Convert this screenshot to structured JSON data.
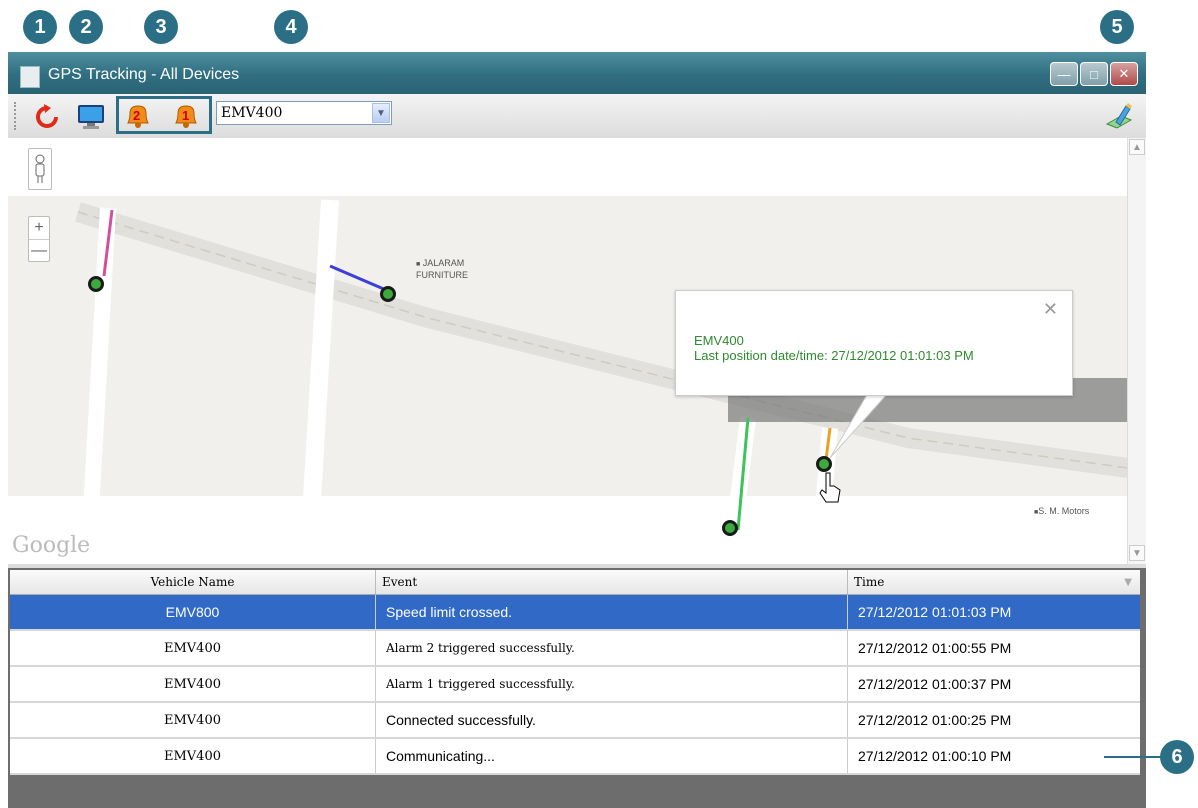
{
  "callouts": [
    "1",
    "2",
    "3",
    "4",
    "5",
    "6"
  ],
  "window": {
    "title": "GPS Tracking - All Devices",
    "controls": [
      "minimize-icon",
      "maximize-icon",
      "close-icon"
    ]
  },
  "toolbar": {
    "refresh_icon": "refresh-icon",
    "monitor_icon": "monitor-icon",
    "alarm2_label": "2",
    "alarm1_label": "1",
    "device_selected": "EMV400",
    "edit_icon": "pencil-icon"
  },
  "map": {
    "labels": {
      "jalaram": "JALARAM FURNITURE",
      "sm_motors": "S. M. Motors",
      "google": "Google"
    },
    "popup": {
      "vehicle": "EMV400",
      "last_position": "Last position date/time: 27/12/2012 01:01:03 PM"
    },
    "track_colors": {
      "pink": "#d24fa0",
      "blue": "#3b3fd6",
      "green": "#3cc35a",
      "orange": "#f0a020"
    }
  },
  "grid": {
    "columns": [
      "Vehicle Name",
      "Event",
      "Time"
    ],
    "rows": [
      {
        "vehicle": "EMV800",
        "event": "Speed limit crossed.",
        "time": "27/12/2012  01:01:03 PM",
        "selected": true
      },
      {
        "vehicle": "EMV400",
        "event": "Alarm 2 triggered successfully.",
        "time": "27/12/2012  01:00:55 PM",
        "selected": false
      },
      {
        "vehicle": "EMV400",
        "event": "Alarm 1 triggered successfully.",
        "time": "27/12/2012  01:00:37 PM",
        "selected": false
      },
      {
        "vehicle": "EMV400",
        "event": "Connected successfully.",
        "time": "27/12/2012  01:00:25 PM",
        "selected": false
      },
      {
        "vehicle": "EMV400",
        "event": "Communicating...",
        "time": "27/12/2012  01:00:10 PM",
        "selected": false
      }
    ]
  }
}
